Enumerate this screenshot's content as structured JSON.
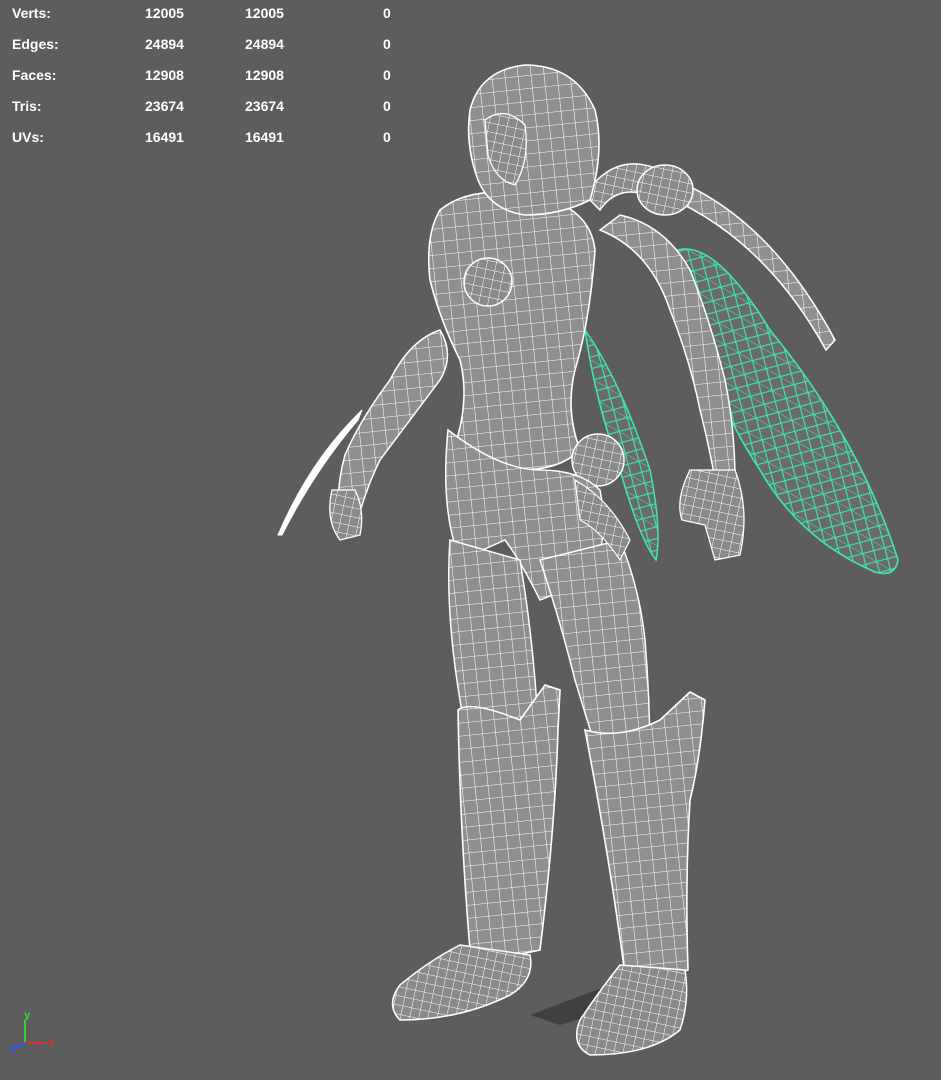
{
  "hud": {
    "rows": [
      {
        "label": "Verts:",
        "values": [
          "12005",
          "12005",
          "0"
        ]
      },
      {
        "label": "Edges:",
        "values": [
          "24894",
          "24894",
          "0"
        ]
      },
      {
        "label": "Faces:",
        "values": [
          "12908",
          "12908",
          "0"
        ]
      },
      {
        "label": "Tris:",
        "values": [
          "23674",
          "23674",
          "0"
        ]
      },
      {
        "label": "UVs:",
        "values": [
          "16491",
          "16491",
          "0"
        ]
      }
    ]
  },
  "axis": {
    "x": "x",
    "y": "y",
    "z": "z"
  },
  "colors": {
    "background": "#5d5d5d",
    "wireframe": "#ffffff",
    "selection": "#3fe8b0",
    "axis_x": "#e03030",
    "axis_y": "#30d030",
    "axis_z": "#3050ff"
  },
  "viewport": {
    "content": "wireframe-character-model",
    "selected_part": "wings"
  }
}
